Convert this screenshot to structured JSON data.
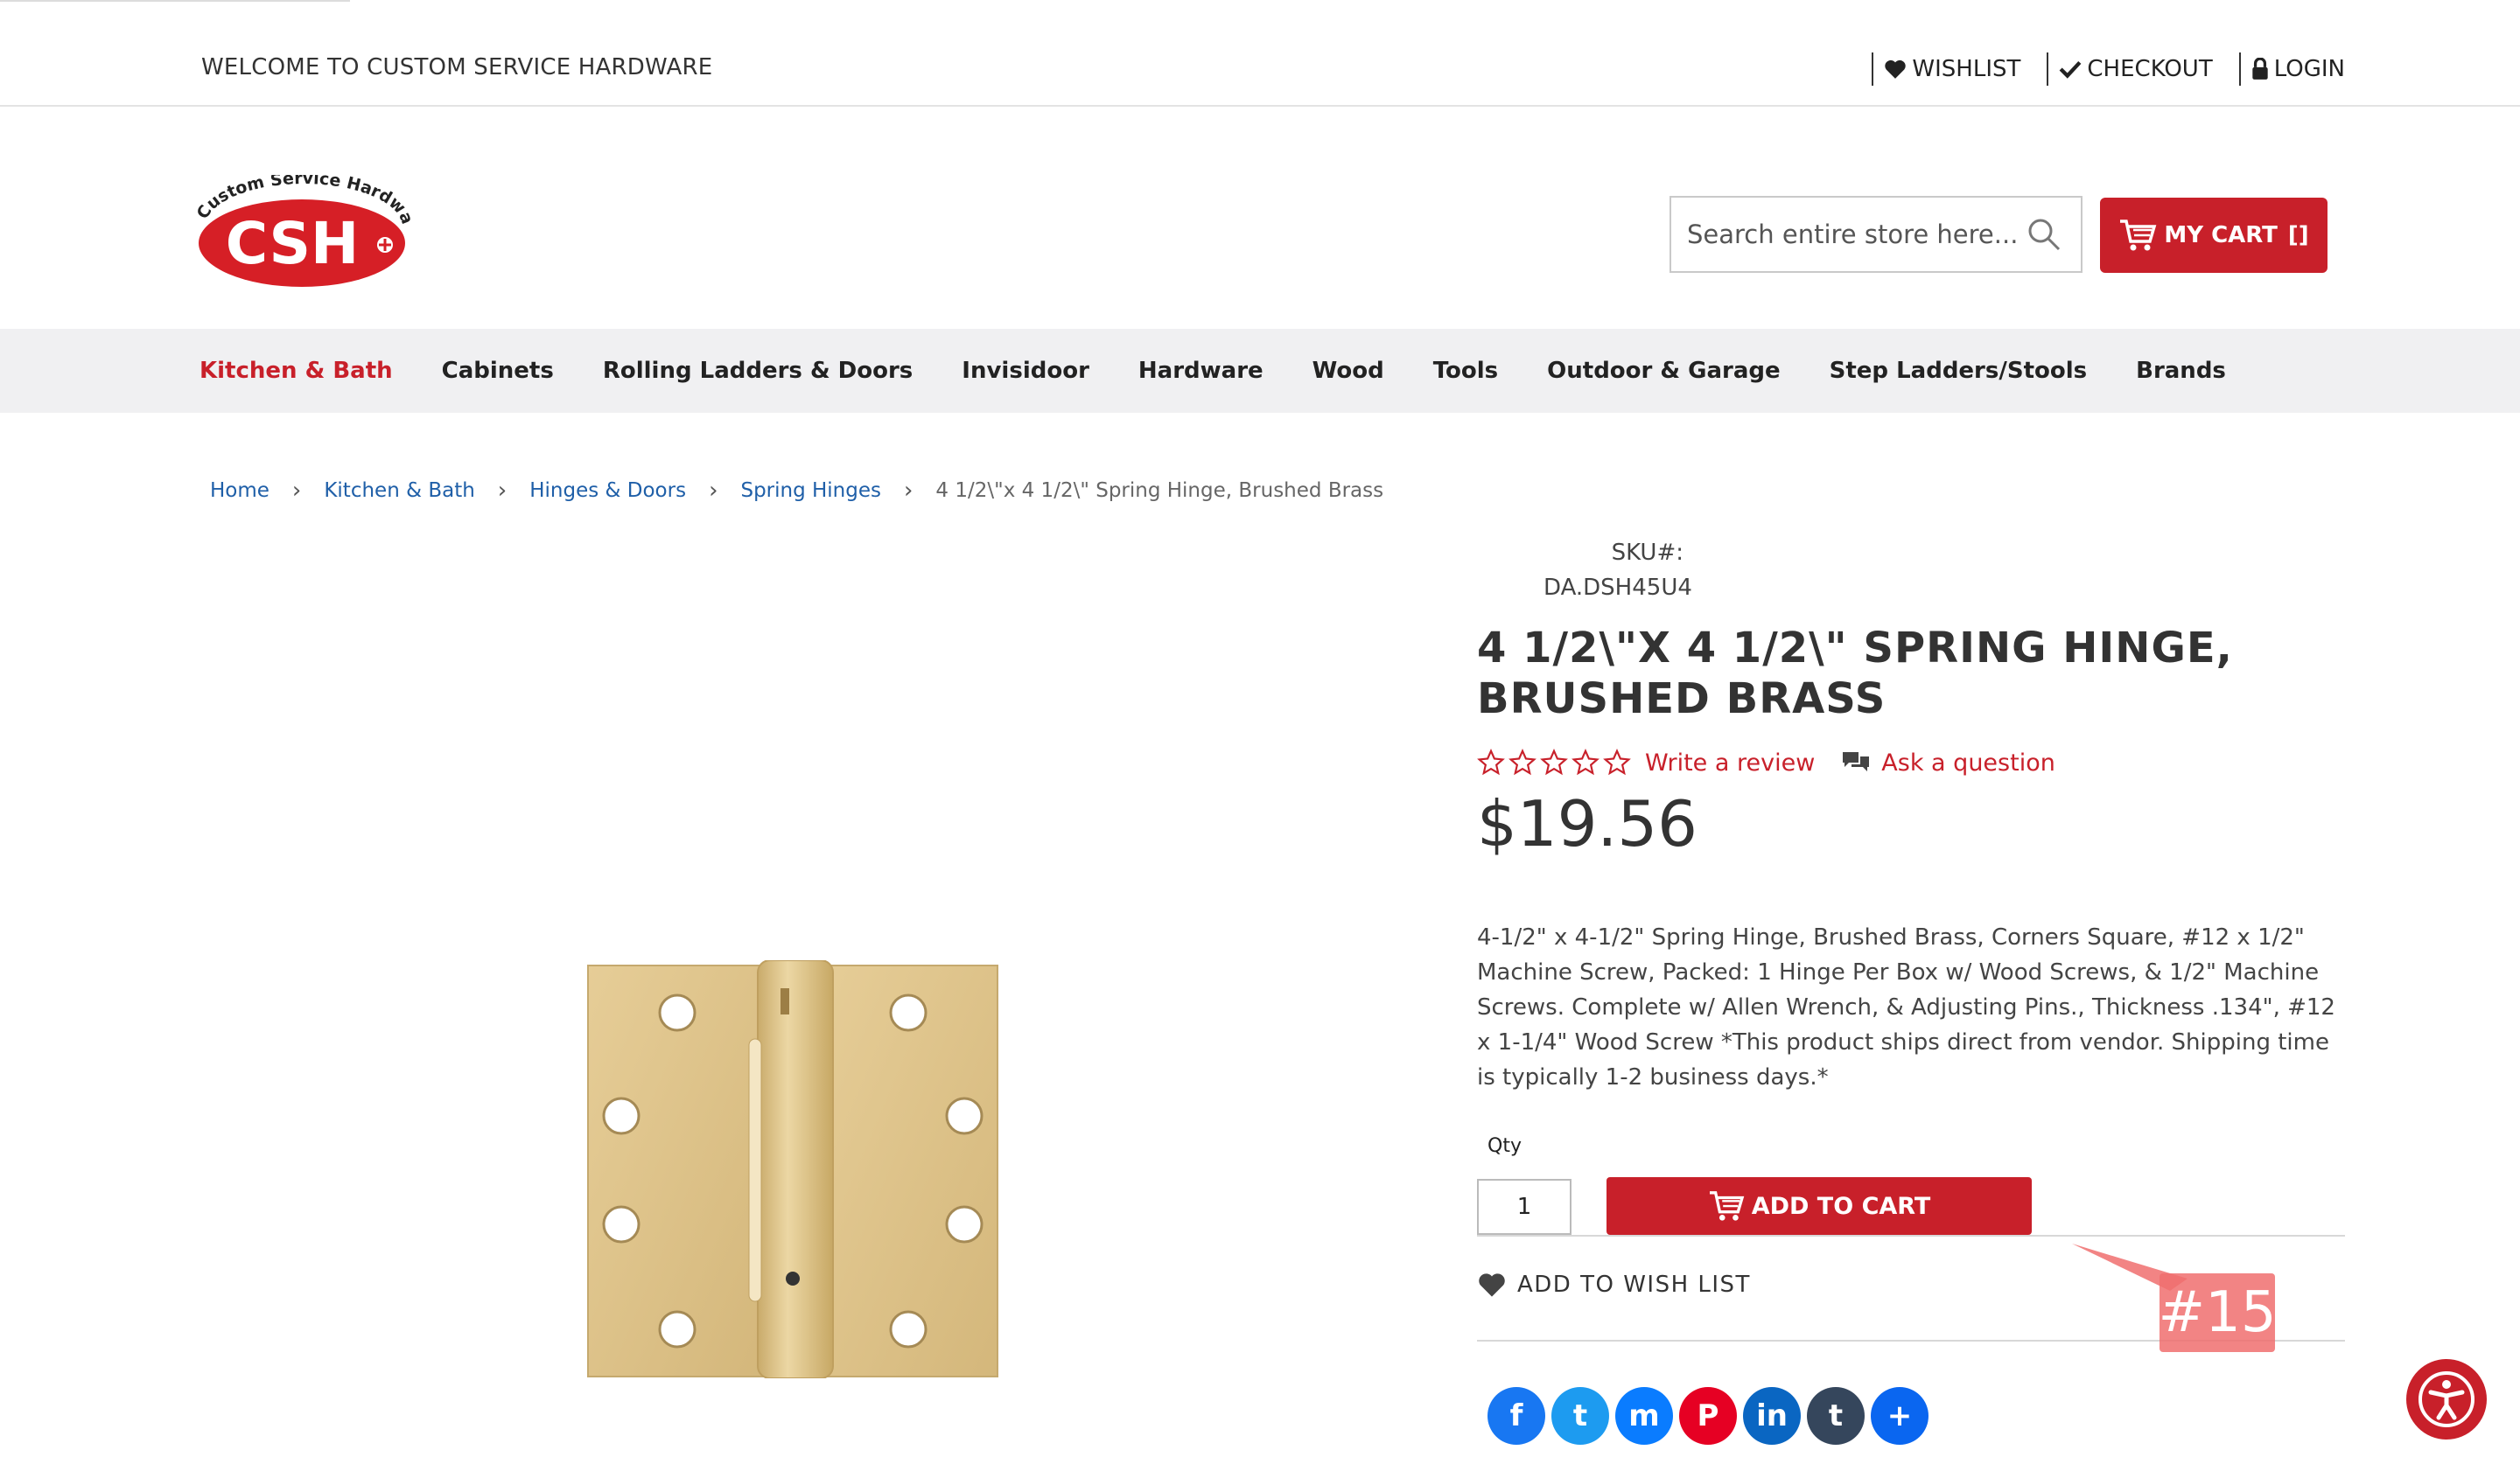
{
  "topbar": {
    "welcome": "WELCOME TO CUSTOM SERVICE HARDWARE",
    "wishlist": "WISHLIST",
    "checkout": "CHECKOUT",
    "login": "LOGIN"
  },
  "header": {
    "logo_text": "CSH",
    "logo_tagline": "Custom Service Hardware",
    "search_placeholder": "Search entire store here...",
    "cart_label": "MY CART",
    "cart_count": "[]"
  },
  "nav": {
    "items": [
      {
        "label": "Kitchen & Bath",
        "active": true
      },
      {
        "label": "Cabinets"
      },
      {
        "label": "Rolling Ladders & Doors"
      },
      {
        "label": "Invisidoor"
      },
      {
        "label": "Hardware"
      },
      {
        "label": "Wood"
      },
      {
        "label": "Tools"
      },
      {
        "label": "Outdoor & Garage"
      },
      {
        "label": "Step Ladders/Stools"
      },
      {
        "label": "Brands"
      }
    ]
  },
  "breadcrumb": {
    "items": [
      "Home",
      "Kitchen & Bath",
      "Hinges & Doors",
      "Spring Hinges"
    ],
    "current": "4 1/2\\\"x 4 1/2\\\" Spring Hinge, Brushed Brass"
  },
  "product": {
    "sku_label": "SKU#:",
    "sku": "DA.DSH45U4",
    "title": "4 1/2\\\"X 4 1/2\\\" SPRING HINGE, BRUSHED BRASS",
    "write_review": "Write a review",
    "ask_question": "Ask a question",
    "rating": 0,
    "price": "$19.56",
    "description": "4-1/2\" x 4-1/2\" Spring Hinge, Brushed Brass, Corners Square, #12 x 1/2\" Machine Screw, Packed: 1 Hinge Per Box w/ Wood Screws, & 1/2\" Machine Screws. Complete w/ Allen Wrench, & Adjusting Pins., Thickness .134\", #12 x 1-1/4\" Wood Screw *This product ships direct from vendor. Shipping time is typically 1-2 business days.*",
    "qty_label": "Qty",
    "qty_value": "1",
    "add_to_cart": "ADD TO CART",
    "add_to_wishlist": "ADD TO WISH LIST"
  },
  "share": {
    "icons": [
      {
        "name": "facebook-icon",
        "glyph": "f",
        "color": "#1877f2"
      },
      {
        "name": "twitter-icon",
        "glyph": "t",
        "color": "#1d9bf0"
      },
      {
        "name": "messenger-icon",
        "glyph": "m",
        "color": "#0a7cff"
      },
      {
        "name": "pinterest-icon",
        "glyph": "P",
        "color": "#e60023"
      },
      {
        "name": "linkedin-icon",
        "glyph": "in",
        "color": "#0a66c2"
      },
      {
        "name": "tumblr-icon",
        "glyph": "t",
        "color": "#35465c"
      },
      {
        "name": "share-more-icon",
        "glyph": "+",
        "color": "#0a66f0"
      }
    ]
  },
  "annotation": {
    "marker": "#15"
  },
  "colors": {
    "brand_red": "#c8202a",
    "link_blue": "#1f5fa8",
    "nav_bg": "#f0f0f2",
    "brass": "#d9bf85"
  }
}
